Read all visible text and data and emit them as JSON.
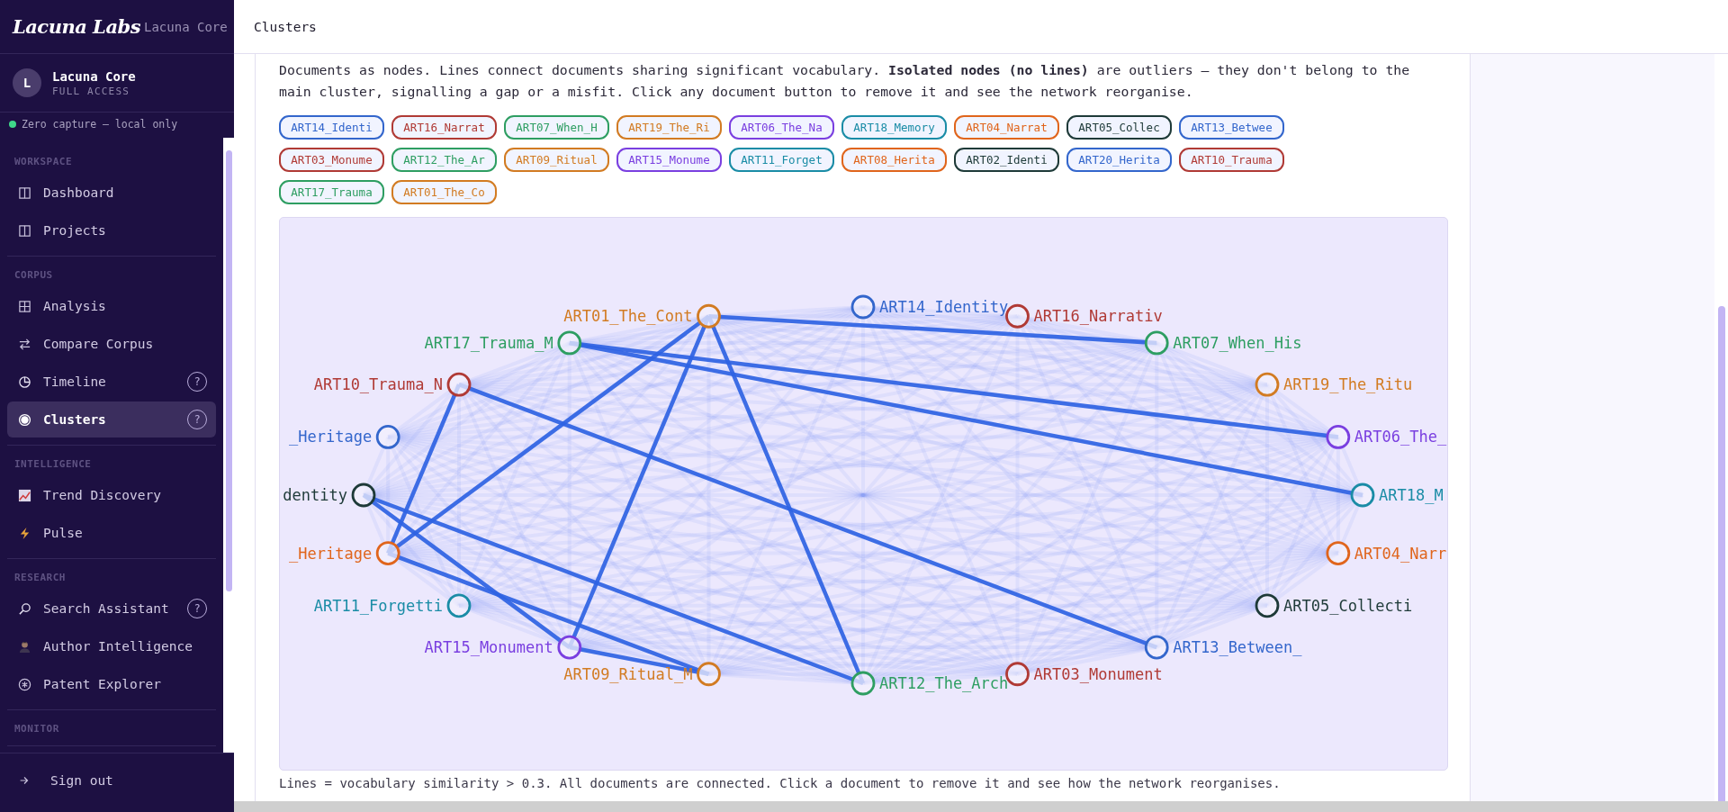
{
  "sidebar": {
    "logo": "Lacuna Labs",
    "product": "Lacuna Core",
    "user": {
      "avatar": "L",
      "name": "Lacuna Core",
      "role": "FULL ACCESS"
    },
    "privacy": "Zero capture — local only",
    "sections": [
      {
        "title": "WORKSPACE",
        "items": [
          {
            "label": "Dashboard",
            "selected": false
          },
          {
            "label": "Projects",
            "selected": false
          }
        ]
      },
      {
        "title": "CORPUS",
        "items": [
          {
            "label": "Analysis",
            "selected": false
          },
          {
            "label": "Compare Corpus",
            "selected": false
          },
          {
            "label": "Timeline",
            "selected": false,
            "help": "?"
          },
          {
            "label": "Clusters",
            "selected": true,
            "help": "?"
          }
        ]
      },
      {
        "title": "INTELLIGENCE",
        "items": [
          {
            "label": "Trend Discovery",
            "selected": false
          },
          {
            "label": "Pulse",
            "selected": false
          }
        ]
      },
      {
        "title": "RESEARCH",
        "items": [
          {
            "label": "Search Assistant",
            "selected": false,
            "help": "?"
          },
          {
            "label": "Author Intelligence",
            "selected": false
          },
          {
            "label": "Patent Explorer",
            "selected": false
          }
        ]
      },
      {
        "title": "MONITOR"
      }
    ],
    "sign_out": "Sign out"
  },
  "header": {
    "title": "Clusters"
  },
  "intro": "Documents as nodes. Lines connect documents sharing significant vocabulary. **Isolated nodes (no lines)** are outliers — they don't belong to the main cluster, signalling a gap or a misfit. Click any document button to remove it and see the network reorganise.",
  "document_buttons": [
    {
      "label": "ART14_Identi",
      "color": "#3366cc"
    },
    {
      "label": "ART16_Narrat",
      "color": "#b03a35"
    },
    {
      "label": "ART07_When_H",
      "color": "#2e9e62"
    },
    {
      "label": "ART19_The_Ri",
      "color": "#d27b22"
    },
    {
      "label": "ART06_The_Na",
      "color": "#7a3fe0"
    },
    {
      "label": "ART18_Memory",
      "color": "#1a8ca6"
    },
    {
      "label": "ART04_Narrat",
      "color": "#e0651c"
    },
    {
      "label": "ART05_Collec",
      "color": "#1e3a38"
    },
    {
      "label": "ART13_Betwee",
      "color": "#3366cc"
    },
    {
      "label": "ART03_Monume",
      "color": "#b03a35"
    },
    {
      "label": "ART12_The_Ar",
      "color": "#2e9e62"
    },
    {
      "label": "ART09_Ritual",
      "color": "#d27b22"
    },
    {
      "label": "ART15_Monume",
      "color": "#7a3fe0"
    },
    {
      "label": "ART11_Forget",
      "color": "#1a8ca6"
    },
    {
      "label": "ART08_Herita",
      "color": "#e0651c"
    },
    {
      "label": "ART02_Identi",
      "color": "#1e3a38"
    },
    {
      "label": "ART20_Herita",
      "color": "#3366cc"
    },
    {
      "label": "ART10_Trauma",
      "color": "#b03a35"
    },
    {
      "label": "ART17_Trauma",
      "color": "#2e9e62"
    },
    {
      "label": "ART01_The_Co",
      "color": "#d27b22"
    }
  ],
  "graph": {
    "right_arc": [
      {
        "label": "ART14_Identity",
        "color": "#3366cc"
      },
      {
        "label": "ART16_Narrativ",
        "color": "#b03a35"
      },
      {
        "label": "ART07_When_His",
        "color": "#2e9e62"
      },
      {
        "label": "ART19_The_Ritu",
        "color": "#d27b22"
      },
      {
        "label": "ART06_The_",
        "color": "#7a3fe0"
      },
      {
        "label": "ART18_M",
        "color": "#1a8ca6"
      },
      {
        "label": "ART04_Narr",
        "color": "#e0651c"
      },
      {
        "label": "ART05_Collecti",
        "color": "#1e3a38"
      },
      {
        "label": "ART13_Between_",
        "color": "#3366cc"
      },
      {
        "label": "ART03_Monument",
        "color": "#b03a35"
      },
      {
        "label": "ART12_The_Arch",
        "color": "#2e9e62"
      }
    ],
    "left_arc": [
      {
        "label": "ART01_The_Cont",
        "color": "#d27b22"
      },
      {
        "label": "ART17_Trauma_M",
        "color": "#2e9e62"
      },
      {
        "label": "ART10_Trauma_N",
        "color": "#b03a35"
      },
      {
        "label": "_Heritage",
        "color": "#3366cc"
      },
      {
        "label": "dentity",
        "color": "#1e3a38"
      },
      {
        "label": "_Heritage",
        "color": "#e0651c"
      },
      {
        "label": "ART11_Forgetti",
        "color": "#1a8ca6"
      },
      {
        "label": "ART15_Monument",
        "color": "#7a3fe0"
      },
      {
        "label": "ART09_Ritual_M",
        "color": "#d27b22"
      }
    ]
  },
  "caption": "Lines = vocabulary similarity > 0.3. All documents are connected. Click a document to remove it and see how the network reorganises."
}
